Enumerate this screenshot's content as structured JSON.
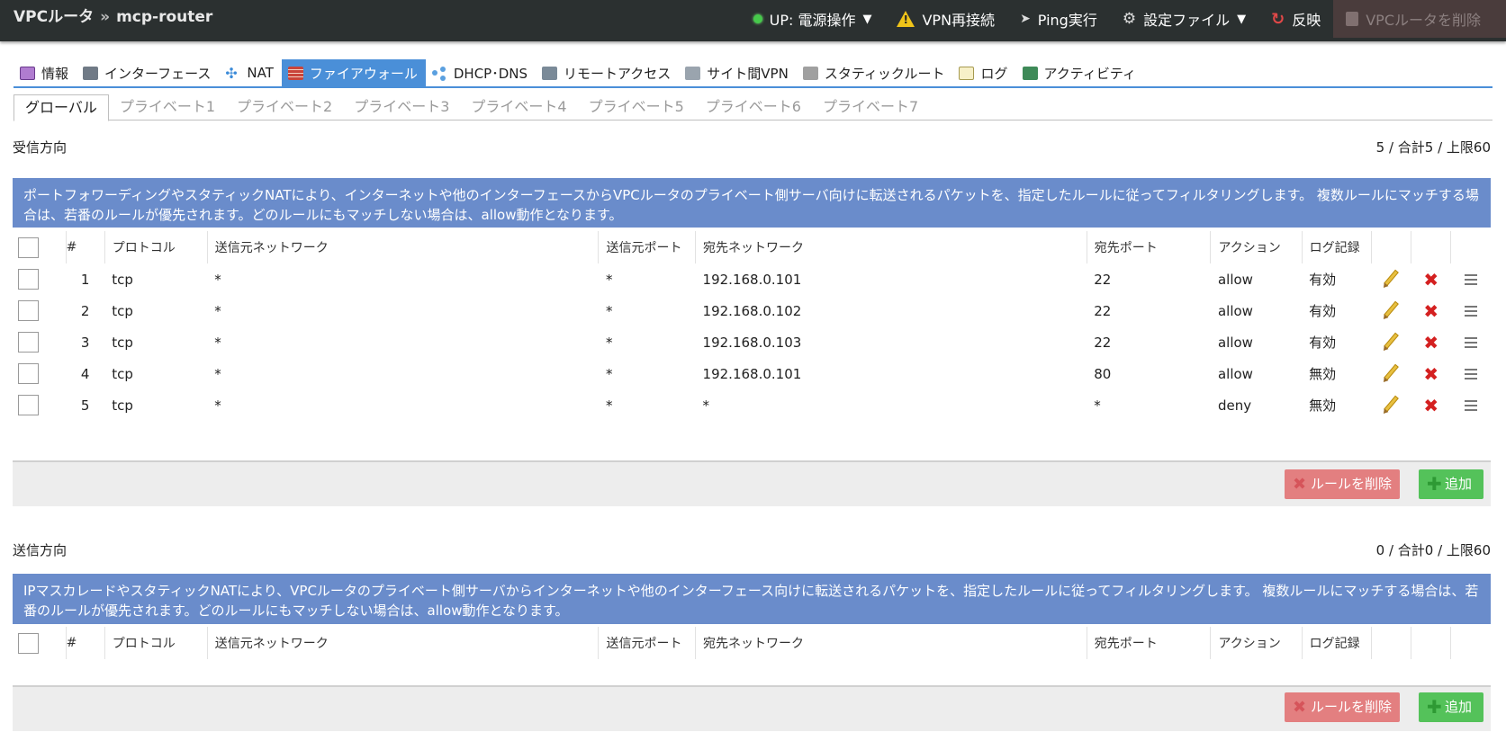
{
  "header": {
    "breadcrumb_root": "VPCルータ",
    "breadcrumb_sep": "»",
    "router_name": "mcp-router",
    "actions": {
      "power": "UP: 電源操作",
      "power_caret": "▼",
      "vpn": "VPN再接続",
      "ping": "Ping実行",
      "config": "設定ファイル",
      "config_caret": "▼",
      "apply": "反映",
      "delete": "VPCルータを削除"
    }
  },
  "tabs": {
    "info": "情報",
    "interface": "インターフェース",
    "nat": "NAT",
    "firewall": "ファイアウォール",
    "dhcp": "DHCP･DNS",
    "remote": "リモートアクセス",
    "site": "サイト間VPN",
    "static": "スタティックルート",
    "log": "ログ",
    "activity": "アクティビティ"
  },
  "subtabs": [
    "グローバル",
    "プライベート1",
    "プライベート2",
    "プライベート3",
    "プライベート4",
    "プライベート5",
    "プライベート6",
    "プライベート7"
  ],
  "columns": {
    "num": "#",
    "protocol": "プロトコル",
    "src_net": "送信元ネットワーク",
    "src_port": "送信元ポート",
    "dst_net": "宛先ネットワーク",
    "dst_port": "宛先ポート",
    "action": "アクション",
    "log": "ログ記録"
  },
  "buttons": {
    "delete_rule": "ルールを削除",
    "add": "追加"
  },
  "inbound": {
    "title": "受信方向",
    "count": "5 / 合計5 / 上限60",
    "description": "ポートフォワーディングやスタティックNATにより、インターネットや他のインターフェースからVPCルータのプライベート側サーバ向けに転送されるパケットを、指定したルールに従ってフィルタリングします。 複数ルールにマッチする場合は、若番のルールが優先されます。どのルールにもマッチしない場合は、allow動作となります。",
    "rules": [
      {
        "num": "1",
        "protocol": "tcp",
        "src_net": "*",
        "src_port": "*",
        "dst_net": "192.168.0.101",
        "dst_port": "22",
        "action": "allow",
        "log": "有効"
      },
      {
        "num": "2",
        "protocol": "tcp",
        "src_net": "*",
        "src_port": "*",
        "dst_net": "192.168.0.102",
        "dst_port": "22",
        "action": "allow",
        "log": "有効"
      },
      {
        "num": "3",
        "protocol": "tcp",
        "src_net": "*",
        "src_port": "*",
        "dst_net": "192.168.0.103",
        "dst_port": "22",
        "action": "allow",
        "log": "有効"
      },
      {
        "num": "4",
        "protocol": "tcp",
        "src_net": "*",
        "src_port": "*",
        "dst_net": "192.168.0.101",
        "dst_port": "80",
        "action": "allow",
        "log": "無効"
      },
      {
        "num": "5",
        "protocol": "tcp",
        "src_net": "*",
        "src_port": "*",
        "dst_net": "*",
        "dst_port": "*",
        "action": "deny",
        "log": "無効"
      }
    ]
  },
  "outbound": {
    "title": "送信方向",
    "count": "0 / 合計0 / 上限60",
    "description": "IPマスカレードやスタティックNATにより、VPCルータのプライベート側サーバからインターネットや他のインターフェース向けに転送されるパケットを、指定したルールに従ってフィルタリングします。 複数ルールにマッチする場合は、若番のルールが優先されます。どのルールにもマッチしない場合は、allow動作となります。",
    "rules": []
  },
  "colors": {
    "header_bg": "#2b3030",
    "active_tab": "#4a8fd8",
    "info_box": "#6a8ccb",
    "delete_button": "#e37f80",
    "add_button": "#54c25a"
  },
  "icons": {
    "power": "status-dot-green",
    "vpn": "warning-icon",
    "ping": "paper-plane-icon",
    "config": "gear-icon",
    "apply": "refresh-icon",
    "delete": "trash-icon",
    "row_edit": "pencil-icon",
    "row_delete": "x-icon",
    "row_drag": "drag-handle-icon"
  }
}
